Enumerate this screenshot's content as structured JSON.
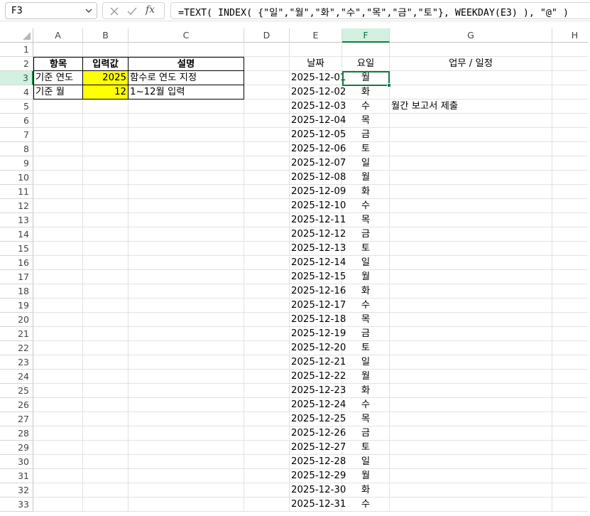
{
  "formula_bar": {
    "name_box": "F3",
    "fx_label": "fx",
    "formula": "=TEXT( INDEX( {\"일\",\"월\",\"화\",\"수\",\"목\",\"금\",\"토\"}, WEEKDAY(E3) ), \"@\" )"
  },
  "columns": [
    "A",
    "B",
    "C",
    "D",
    "E",
    "F",
    "G",
    "H"
  ],
  "selected_column": "F",
  "selected_row": "3",
  "rows": [
    "1",
    "2",
    "3",
    "4",
    "5",
    "6",
    "7",
    "8",
    "9",
    "10",
    "11",
    "12",
    "13",
    "14",
    "15",
    "16",
    "17",
    "18",
    "19",
    "20",
    "21",
    "22",
    "23",
    "24",
    "25",
    "26",
    "27",
    "28",
    "29",
    "30",
    "31",
    "32",
    "33"
  ],
  "input_table": {
    "headers": {
      "item": "항목",
      "value": "입력값",
      "desc": "설명"
    },
    "rows": [
      {
        "item": "기준 연도",
        "value": "2025",
        "desc": "함수로 연도 지정"
      },
      {
        "item": "기준 월",
        "value": "12",
        "desc": "1~12월 입력"
      }
    ]
  },
  "calendar": {
    "headers": {
      "date": "날짜",
      "weekday": "요일",
      "task": "업무 / 일정"
    },
    "entries": [
      {
        "date": "2025-12-01",
        "weekday": "월",
        "task": ""
      },
      {
        "date": "2025-12-02",
        "weekday": "화",
        "task": ""
      },
      {
        "date": "2025-12-03",
        "weekday": "수",
        "task": "월간 보고서 제출"
      },
      {
        "date": "2025-12-04",
        "weekday": "목",
        "task": ""
      },
      {
        "date": "2025-12-05",
        "weekday": "금",
        "task": ""
      },
      {
        "date": "2025-12-06",
        "weekday": "토",
        "task": ""
      },
      {
        "date": "2025-12-07",
        "weekday": "일",
        "task": ""
      },
      {
        "date": "2025-12-08",
        "weekday": "월",
        "task": ""
      },
      {
        "date": "2025-12-09",
        "weekday": "화",
        "task": ""
      },
      {
        "date": "2025-12-10",
        "weekday": "수",
        "task": ""
      },
      {
        "date": "2025-12-11",
        "weekday": "목",
        "task": ""
      },
      {
        "date": "2025-12-12",
        "weekday": "금",
        "task": ""
      },
      {
        "date": "2025-12-13",
        "weekday": "토",
        "task": ""
      },
      {
        "date": "2025-12-14",
        "weekday": "일",
        "task": ""
      },
      {
        "date": "2025-12-15",
        "weekday": "월",
        "task": ""
      },
      {
        "date": "2025-12-16",
        "weekday": "화",
        "task": ""
      },
      {
        "date": "2025-12-17",
        "weekday": "수",
        "task": ""
      },
      {
        "date": "2025-12-18",
        "weekday": "목",
        "task": ""
      },
      {
        "date": "2025-12-19",
        "weekday": "금",
        "task": ""
      },
      {
        "date": "2025-12-20",
        "weekday": "토",
        "task": ""
      },
      {
        "date": "2025-12-21",
        "weekday": "일",
        "task": ""
      },
      {
        "date": "2025-12-22",
        "weekday": "월",
        "task": ""
      },
      {
        "date": "2025-12-23",
        "weekday": "화",
        "task": ""
      },
      {
        "date": "2025-12-24",
        "weekday": "수",
        "task": ""
      },
      {
        "date": "2025-12-25",
        "weekday": "목",
        "task": ""
      },
      {
        "date": "2025-12-26",
        "weekday": "금",
        "task": ""
      },
      {
        "date": "2025-12-27",
        "weekday": "토",
        "task": ""
      },
      {
        "date": "2025-12-28",
        "weekday": "일",
        "task": ""
      },
      {
        "date": "2025-12-29",
        "weekday": "월",
        "task": ""
      },
      {
        "date": "2025-12-30",
        "weekday": "화",
        "task": ""
      },
      {
        "date": "2025-12-31",
        "weekday": "수",
        "task": ""
      }
    ]
  },
  "icons": {
    "name_box_dropdown": "chevron-down-icon",
    "cancel": "close-icon",
    "enter": "check-icon",
    "insert_function": "fx-icon",
    "select_all": "select-all-triangle-icon"
  },
  "colors": {
    "selection_green": "#107c41",
    "selection_header_bg": "#d3f0e0",
    "input_highlight": "#ffff00"
  }
}
